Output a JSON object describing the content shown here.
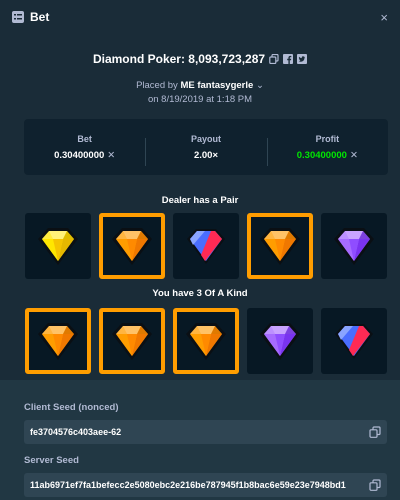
{
  "header": {
    "title": "Bet",
    "close_glyph": "×"
  },
  "game": {
    "title": "Diamond Poker: 8,093,723,287"
  },
  "placed": {
    "prefix": "Placed by",
    "user": "ME fantasygerle",
    "date": "on 8/19/2019 at 1:18 PM"
  },
  "stats": {
    "bet_label": "Bet",
    "bet_value": "0.30400000",
    "payout_label": "Payout",
    "payout_value": "2.00×",
    "profit_label": "Profit",
    "profit_value": "0.30400000",
    "currency_glyph": "✕"
  },
  "dealer": {
    "label": "Dealer has a Pair",
    "cards": [
      {
        "gem": "yellow",
        "highlighted": false
      },
      {
        "gem": "orange",
        "highlighted": true
      },
      {
        "gem": "blue-red",
        "highlighted": false
      },
      {
        "gem": "orange",
        "highlighted": true
      },
      {
        "gem": "purple",
        "highlighted": false
      }
    ]
  },
  "player": {
    "label": "You have 3 Of A Kind",
    "cards": [
      {
        "gem": "orange",
        "highlighted": true
      },
      {
        "gem": "orange",
        "highlighted": true
      },
      {
        "gem": "orange",
        "highlighted": true
      },
      {
        "gem": "purple",
        "highlighted": false
      },
      {
        "gem": "blue-red",
        "highlighted": false
      }
    ]
  },
  "seeds": {
    "client_label": "Client Seed (nonced)",
    "client_value": "fe3704576c403aee-62",
    "server_label": "Server Seed",
    "server_value": "11ab6971ef7fa1befecc2e5080ebc2e216be787945f1b8bac6e59e23e7948bd1"
  },
  "colors": {
    "modal_bg": "#1a2c38",
    "panel_bg": "#0f212e",
    "highlight": "#ff9d00",
    "profit_green": "#00e701"
  },
  "icons": [
    "bet-list-icon",
    "close-icon",
    "copy-icon",
    "facebook-icon",
    "twitter-icon",
    "chevron-down-icon",
    "currency-icon"
  ]
}
